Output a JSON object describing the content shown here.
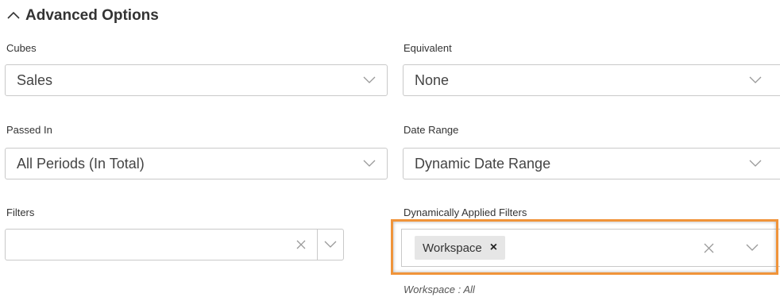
{
  "section": {
    "title": "Advanced Options",
    "icon": "chevron-up-icon"
  },
  "fields": {
    "cubes": {
      "label": "Cubes",
      "value": "Sales"
    },
    "equivalent": {
      "label": "Equivalent",
      "value": "None"
    },
    "passed_in": {
      "label": "Passed In",
      "value": "All Periods (In Total)"
    },
    "date_range": {
      "label": "Date Range",
      "value": "Dynamic Date Range"
    },
    "filters": {
      "label": "Filters",
      "value": ""
    },
    "dynamic_filters": {
      "label": "Dynamically Applied Filters",
      "tags": [
        {
          "label": "Workspace",
          "remove_glyph": "×"
        }
      ],
      "hint": "Workspace : All"
    }
  },
  "colors": {
    "highlight": "#f0943a",
    "border": "#c9c9c9",
    "tag_bg": "#e6e6e6"
  }
}
